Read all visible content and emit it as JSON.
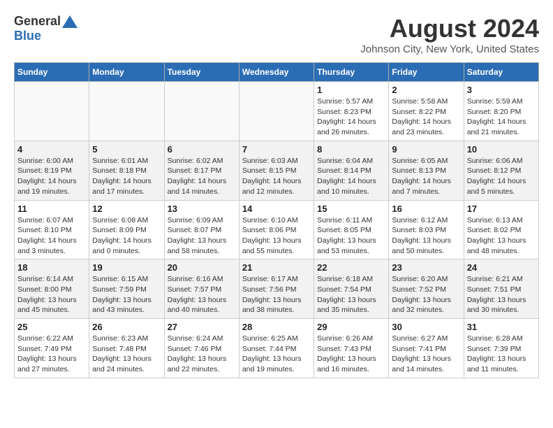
{
  "header": {
    "logo_general": "General",
    "logo_blue": "Blue",
    "month_title": "August 2024",
    "subtitle": "Johnson City, New York, United States"
  },
  "weekdays": [
    "Sunday",
    "Monday",
    "Tuesday",
    "Wednesday",
    "Thursday",
    "Friday",
    "Saturday"
  ],
  "weeks": [
    [
      {
        "date": "",
        "info": ""
      },
      {
        "date": "",
        "info": ""
      },
      {
        "date": "",
        "info": ""
      },
      {
        "date": "",
        "info": ""
      },
      {
        "date": "1",
        "info": "Sunrise: 5:57 AM\nSunset: 8:23 PM\nDaylight: 14 hours\nand 26 minutes."
      },
      {
        "date": "2",
        "info": "Sunrise: 5:58 AM\nSunset: 8:22 PM\nDaylight: 14 hours\nand 23 minutes."
      },
      {
        "date": "3",
        "info": "Sunrise: 5:59 AM\nSunset: 8:20 PM\nDaylight: 14 hours\nand 21 minutes."
      }
    ],
    [
      {
        "date": "4",
        "info": "Sunrise: 6:00 AM\nSunset: 8:19 PM\nDaylight: 14 hours\nand 19 minutes."
      },
      {
        "date": "5",
        "info": "Sunrise: 6:01 AM\nSunset: 8:18 PM\nDaylight: 14 hours\nand 17 minutes."
      },
      {
        "date": "6",
        "info": "Sunrise: 6:02 AM\nSunset: 8:17 PM\nDaylight: 14 hours\nand 14 minutes."
      },
      {
        "date": "7",
        "info": "Sunrise: 6:03 AM\nSunset: 8:15 PM\nDaylight: 14 hours\nand 12 minutes."
      },
      {
        "date": "8",
        "info": "Sunrise: 6:04 AM\nSunset: 8:14 PM\nDaylight: 14 hours\nand 10 minutes."
      },
      {
        "date": "9",
        "info": "Sunrise: 6:05 AM\nSunset: 8:13 PM\nDaylight: 14 hours\nand 7 minutes."
      },
      {
        "date": "10",
        "info": "Sunrise: 6:06 AM\nSunset: 8:12 PM\nDaylight: 14 hours\nand 5 minutes."
      }
    ],
    [
      {
        "date": "11",
        "info": "Sunrise: 6:07 AM\nSunset: 8:10 PM\nDaylight: 14 hours\nand 3 minutes."
      },
      {
        "date": "12",
        "info": "Sunrise: 6:08 AM\nSunset: 8:09 PM\nDaylight: 14 hours\nand 0 minutes."
      },
      {
        "date": "13",
        "info": "Sunrise: 6:09 AM\nSunset: 8:07 PM\nDaylight: 13 hours\nand 58 minutes."
      },
      {
        "date": "14",
        "info": "Sunrise: 6:10 AM\nSunset: 8:06 PM\nDaylight: 13 hours\nand 55 minutes."
      },
      {
        "date": "15",
        "info": "Sunrise: 6:11 AM\nSunset: 8:05 PM\nDaylight: 13 hours\nand 53 minutes."
      },
      {
        "date": "16",
        "info": "Sunrise: 6:12 AM\nSunset: 8:03 PM\nDaylight: 13 hours\nand 50 minutes."
      },
      {
        "date": "17",
        "info": "Sunrise: 6:13 AM\nSunset: 8:02 PM\nDaylight: 13 hours\nand 48 minutes."
      }
    ],
    [
      {
        "date": "18",
        "info": "Sunrise: 6:14 AM\nSunset: 8:00 PM\nDaylight: 13 hours\nand 45 minutes."
      },
      {
        "date": "19",
        "info": "Sunrise: 6:15 AM\nSunset: 7:59 PM\nDaylight: 13 hours\nand 43 minutes."
      },
      {
        "date": "20",
        "info": "Sunrise: 6:16 AM\nSunset: 7:57 PM\nDaylight: 13 hours\nand 40 minutes."
      },
      {
        "date": "21",
        "info": "Sunrise: 6:17 AM\nSunset: 7:56 PM\nDaylight: 13 hours\nand 38 minutes."
      },
      {
        "date": "22",
        "info": "Sunrise: 6:18 AM\nSunset: 7:54 PM\nDaylight: 13 hours\nand 35 minutes."
      },
      {
        "date": "23",
        "info": "Sunrise: 6:20 AM\nSunset: 7:52 PM\nDaylight: 13 hours\nand 32 minutes."
      },
      {
        "date": "24",
        "info": "Sunrise: 6:21 AM\nSunset: 7:51 PM\nDaylight: 13 hours\nand 30 minutes."
      }
    ],
    [
      {
        "date": "25",
        "info": "Sunrise: 6:22 AM\nSunset: 7:49 PM\nDaylight: 13 hours\nand 27 minutes."
      },
      {
        "date": "26",
        "info": "Sunrise: 6:23 AM\nSunset: 7:48 PM\nDaylight: 13 hours\nand 24 minutes."
      },
      {
        "date": "27",
        "info": "Sunrise: 6:24 AM\nSunset: 7:46 PM\nDaylight: 13 hours\nand 22 minutes."
      },
      {
        "date": "28",
        "info": "Sunrise: 6:25 AM\nSunset: 7:44 PM\nDaylight: 13 hours\nand 19 minutes."
      },
      {
        "date": "29",
        "info": "Sunrise: 6:26 AM\nSunset: 7:43 PM\nDaylight: 13 hours\nand 16 minutes."
      },
      {
        "date": "30",
        "info": "Sunrise: 6:27 AM\nSunset: 7:41 PM\nDaylight: 13 hours\nand 14 minutes."
      },
      {
        "date": "31",
        "info": "Sunrise: 6:28 AM\nSunset: 7:39 PM\nDaylight: 13 hours\nand 11 minutes."
      }
    ]
  ]
}
